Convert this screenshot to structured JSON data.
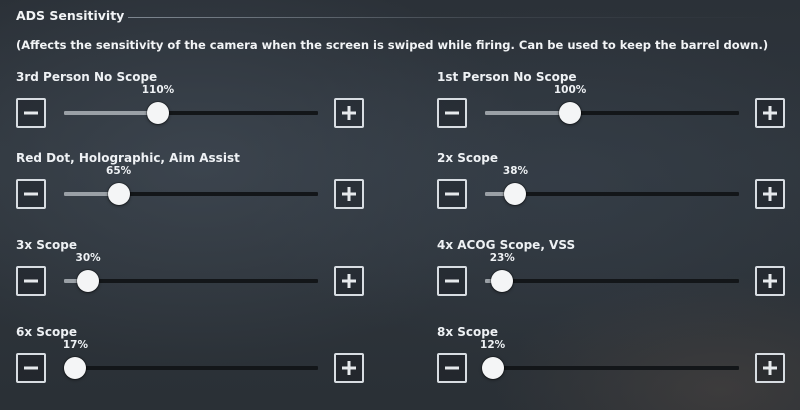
{
  "section": {
    "title": "ADS Sensitivity",
    "description": "(Affects the sensitivity of the camera when the screen is swiped while firing. Can be used to keep the barrel down.)"
  },
  "settings": [
    {
      "label": "3rd Person No Scope",
      "value_text": "110%",
      "level": 0.37
    },
    {
      "label": "1st Person No Scope",
      "value_text": "100%",
      "level": 0.335
    },
    {
      "label": "Red Dot, Holographic, Aim Assist",
      "value_text": "65%",
      "level": 0.215
    },
    {
      "label": "2x Scope",
      "value_text": "38%",
      "level": 0.12
    },
    {
      "label": "3x Scope",
      "value_text": "30%",
      "level": 0.095
    },
    {
      "label": "4x ACOG Scope, VSS",
      "value_text": "23%",
      "level": 0.068
    },
    {
      "label": "6x Scope",
      "value_text": "17%",
      "level": 0.045
    },
    {
      "label": "8x Scope",
      "value_text": "12%",
      "level": 0.03
    }
  ],
  "icons": {
    "decrease": "minus-icon",
    "increase": "plus-icon"
  },
  "colors": {
    "track": "#131619",
    "fill": "#9aa0a6",
    "knob": "#f4f5f6",
    "text": "#eef1f4"
  }
}
